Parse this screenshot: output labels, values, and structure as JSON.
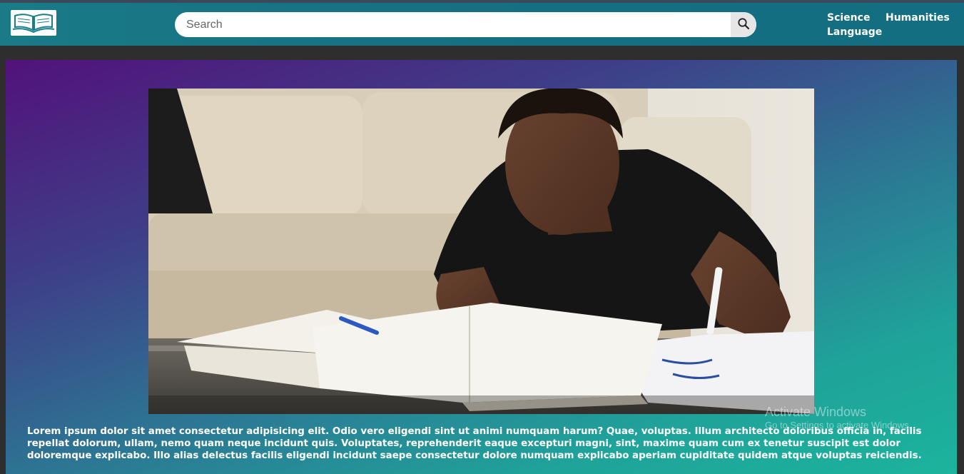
{
  "header": {
    "logo_icon": "open-book-icon",
    "search": {
      "placeholder": "Search",
      "value": "",
      "button_icon": "magnifier-icon"
    },
    "nav": {
      "items": [
        {
          "label": "Science"
        },
        {
          "label": "Humanities"
        },
        {
          "label": "Language"
        }
      ]
    },
    "colors": {
      "bar": "#15707f",
      "page_bg": "#2e2e2e"
    }
  },
  "main": {
    "hero_image": "student-studying-photo",
    "paragraph": "Lorem ipsum dolor sit amet consectetur adipisicing elit. Odio vero eligendi sint ut animi numquam harum? Quae, voluptas. Illum architecto doloribus officia in, facilis repellat dolorum, ullam, nemo quam neque incidunt quis. Voluptates, reprehenderit eaque excepturi magni, sint, maxime quam cum ex tenetur suscipit est dolor doloremque explicabo. Illo alias delectus facilis eligendi incidunt saepe consectetur dolore numquam explicabo aperiam cupiditate quidem atque voluptas reiciendis.",
    "gradient": [
      "#52127a",
      "#2d7493",
      "#1bb49c"
    ]
  },
  "watermark": {
    "title": "Activate Windows",
    "subtitle": "Go to Settings to activate Windows."
  }
}
